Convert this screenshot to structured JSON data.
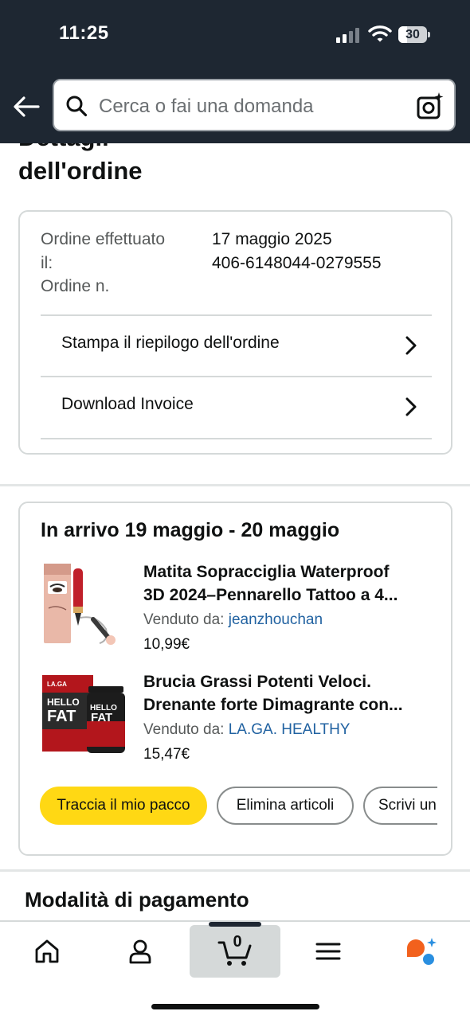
{
  "status": {
    "time": "11:25",
    "battery": "30",
    "battery_level": 0.3
  },
  "search": {
    "placeholder": "Cerca o fai una domanda"
  },
  "page": {
    "title_line1": "Dettagli",
    "title_line2": "dell'ordine"
  },
  "order": {
    "placed_label_1": "Ordine effettuato",
    "placed_label_2": "il:",
    "number_label": "Ordine n.",
    "date": "17 maggio 2025",
    "number": "406-6148044-0279555",
    "actions": [
      {
        "label": "Stampa il riepilogo dell'ordine"
      },
      {
        "label": "Download Invoice"
      }
    ]
  },
  "shipment": {
    "arrival": "In arrivo 19 maggio - 20 maggio",
    "sold_by_label": "Venduto da: ",
    "items": [
      {
        "title_1": "Matita Sopracciglia Waterproof",
        "title_2": "3D 2024–Pennarello Tattoo a 4...",
        "seller": "jeanzhouchan",
        "price": "10,99€",
        "image_icon": "eyebrow-pen-product-image"
      },
      {
        "title_1": "Brucia Grassi Potenti Veloci.",
        "title_2": "Drenante forte Dimagrante con...",
        "seller": "LA.GA. HEALTHY",
        "price": "15,47€",
        "image_icon": "hello-fat-supplement-product-image",
        "box_brand": "LA.GA",
        "box_text_1": "HELLO",
        "box_text_2": "FAT"
      }
    ],
    "buttons": {
      "track": "Traccia il mio pacco",
      "delete": "Elimina articoli",
      "review": "Scrivi un"
    }
  },
  "payment": {
    "title": "Modalità di pagamento"
  },
  "bottom_nav": {
    "items": [
      "home-icon",
      "account-icon",
      "cart-icon",
      "menu-icon",
      "assistant-icon"
    ],
    "cart_count": "0"
  },
  "colors": {
    "header_bg": "#1e2732",
    "primary_button": "#ffd814",
    "link": "#2162a1",
    "text_secondary": "#565959",
    "border": "#d5d9d9"
  }
}
